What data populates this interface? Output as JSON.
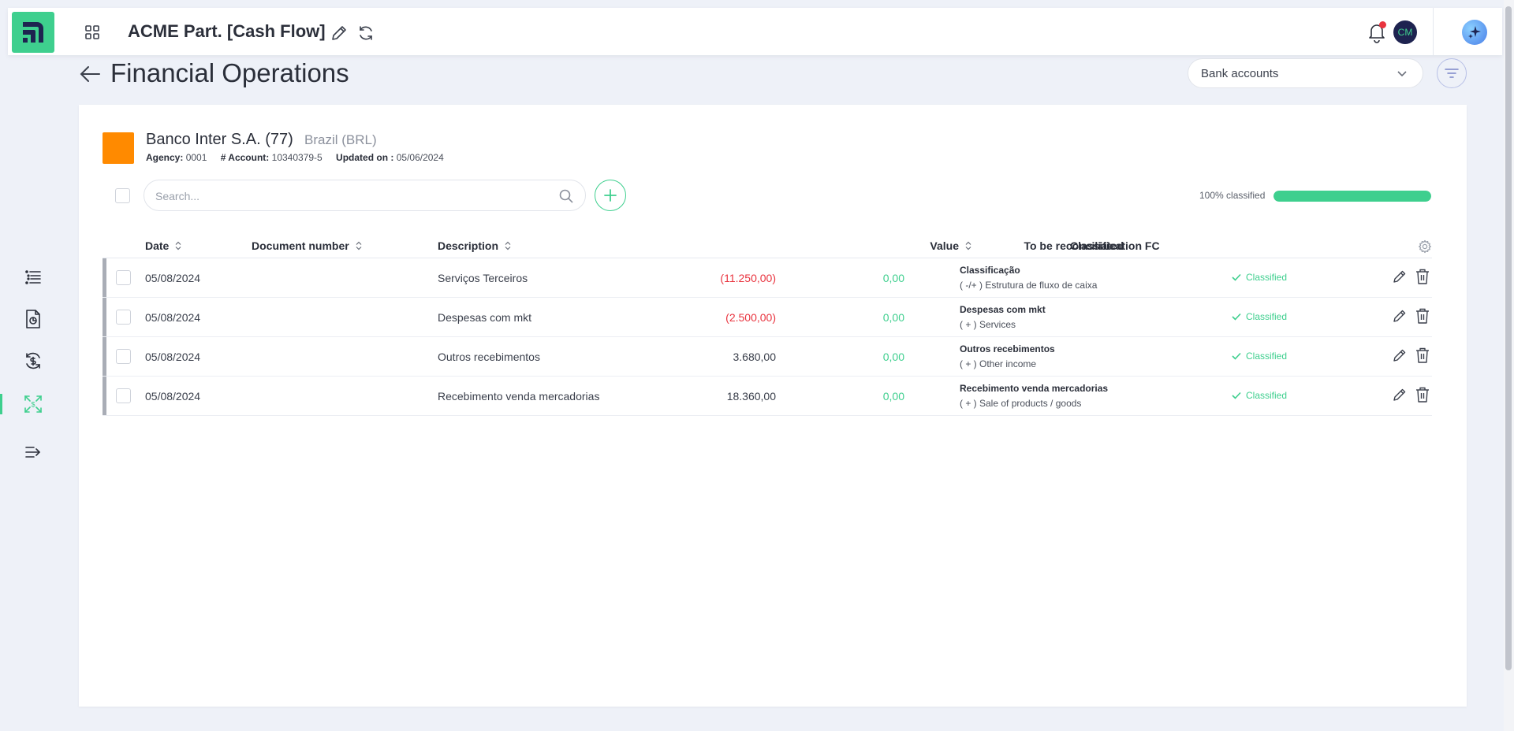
{
  "app": {
    "title": "ACME Part. [Cash Flow]",
    "user_initials": "CM",
    "accent_color": "#3ecf8e"
  },
  "page": {
    "title": "Financial Operations",
    "bank_select_value": "Bank accounts"
  },
  "sidebar": {
    "items": [
      {
        "icon": "list-icon"
      },
      {
        "icon": "document-chart-icon"
      },
      {
        "icon": "exchange-dollar-icon"
      },
      {
        "icon": "expand-arrows-icon",
        "active": true
      },
      {
        "icon": "collapse-menu-icon"
      }
    ]
  },
  "bank": {
    "name": "Banco Inter S.A. (77)",
    "currency": "Brazil (BRL)",
    "agency_label": "Agency:",
    "agency": "0001",
    "account_label": "# Account:",
    "account": "10340379-5",
    "updated_label": "Updated on :",
    "updated": "05/06/2024",
    "color": "#ff8a00"
  },
  "toolbar": {
    "search_placeholder": "Search...",
    "progress_label": "100% classified",
    "progress_percent": 100
  },
  "table": {
    "headers": {
      "date": "Date",
      "document_number": "Document number",
      "description": "Description",
      "value": "Value",
      "to_be_reconciliated": "To be reconciliated",
      "classification": "Classification FC"
    },
    "rows": [
      {
        "date": "05/08/2024",
        "document_number": "",
        "description": "Serviços Terceiros",
        "value": "(11.250,00)",
        "negative": true,
        "reconciliated": "0,00",
        "class_title": "Classificação",
        "class_sub": "( -/+ ) Estrutura de fluxo de caixa",
        "status": "Classified"
      },
      {
        "date": "05/08/2024",
        "document_number": "",
        "description": "Despesas com mkt",
        "value": "(2.500,00)",
        "negative": true,
        "reconciliated": "0,00",
        "class_title": "Despesas com mkt",
        "class_sub": "( + ) Services",
        "status": "Classified"
      },
      {
        "date": "05/08/2024",
        "document_number": "",
        "description": "Outros recebimentos",
        "value": "3.680,00",
        "negative": false,
        "reconciliated": "0,00",
        "class_title": "Outros recebimentos",
        "class_sub": "( + ) Other income",
        "status": "Classified"
      },
      {
        "date": "05/08/2024",
        "document_number": "",
        "description": "Recebimento venda mercadorias",
        "value": "18.360,00",
        "negative": false,
        "reconciliated": "0,00",
        "class_title": "Recebimento venda mercadorias",
        "class_sub": "( + ) Sale of products / goods",
        "status": "Classified"
      }
    ]
  }
}
